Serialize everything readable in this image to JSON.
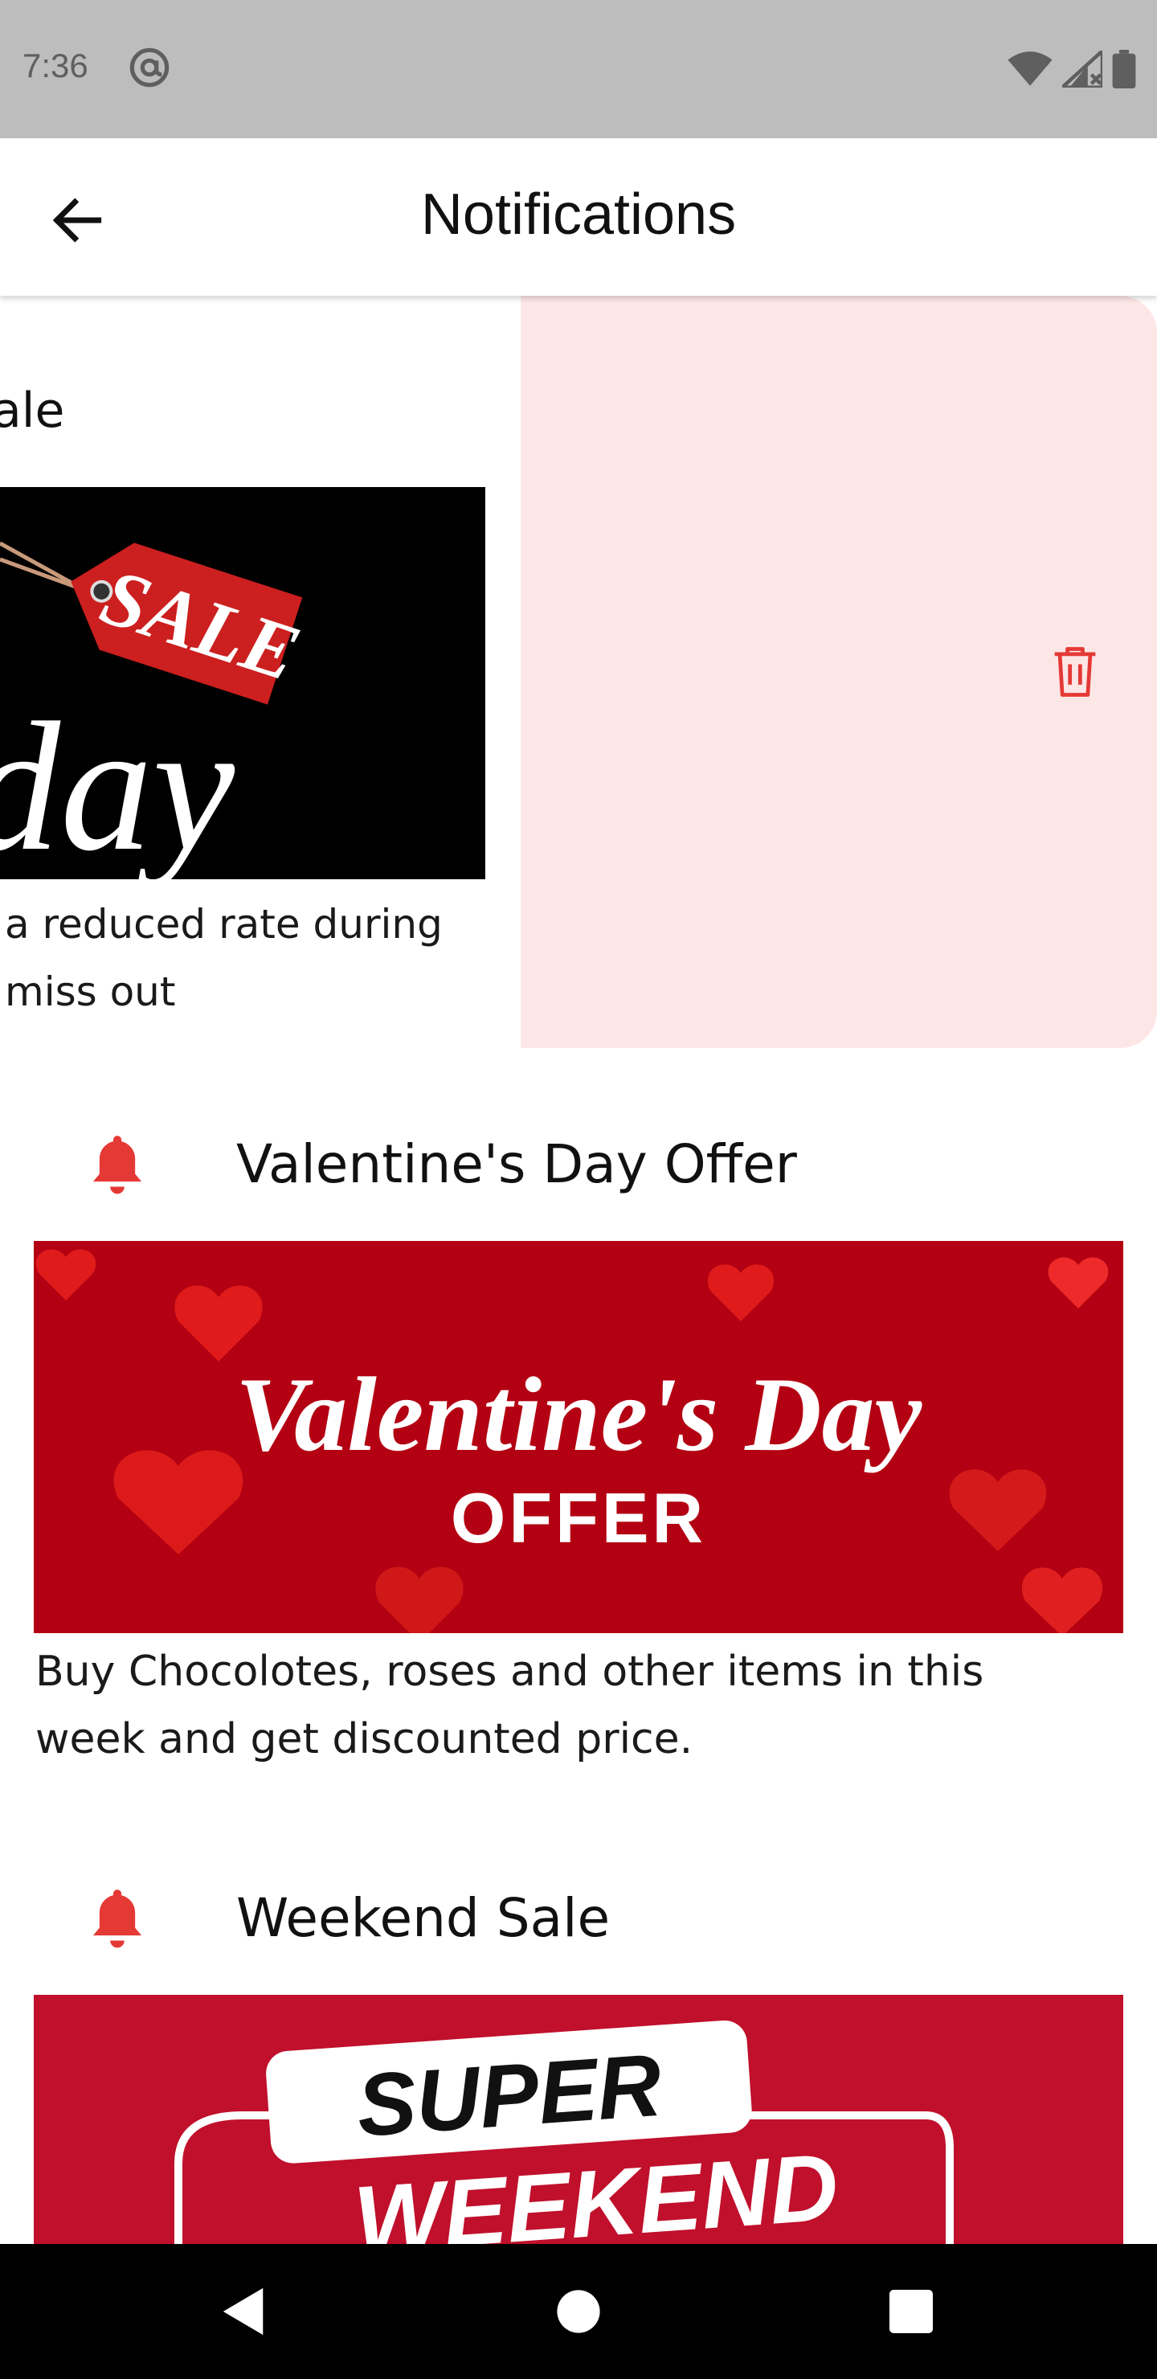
{
  "status_bar": {
    "time": "7:36",
    "icons": [
      "at-sign-icon",
      "wifi-icon",
      "signal-icon",
      "battery-icon"
    ]
  },
  "app_bar": {
    "title": "Notifications",
    "back_icon": "arrow-left-icon"
  },
  "swiped_notification": {
    "title_fragment": "ale",
    "image_text": {
      "sale": "SALE",
      "day": "day"
    },
    "desc_line1": "a reduced rate during",
    "desc_line2": "miss out",
    "delete_icon": "trash-icon"
  },
  "notifications": [
    {
      "title": "Valentine's Day Offer",
      "image_text": {
        "line1": "Valentine's Day",
        "line2": "OFFER"
      },
      "description": "Buy Chocolotes, roses and other items in this week and get discounted price.",
      "icon": "bell-icon"
    },
    {
      "title": "Weekend Sale",
      "image_text": {
        "line1": "SUPER",
        "line2": "WEEKEND"
      },
      "icon": "bell-icon"
    }
  ],
  "nav_bar": {
    "icons": [
      "nav-back-icon",
      "nav-home-icon",
      "nav-recents-icon"
    ]
  },
  "colors": {
    "accent_red": "#e53935",
    "delete_bg": "#fde6e6",
    "valentine_bg": "#b30012",
    "weekend_bg": "#c0102b",
    "status_bar": "#bdbdbd"
  }
}
